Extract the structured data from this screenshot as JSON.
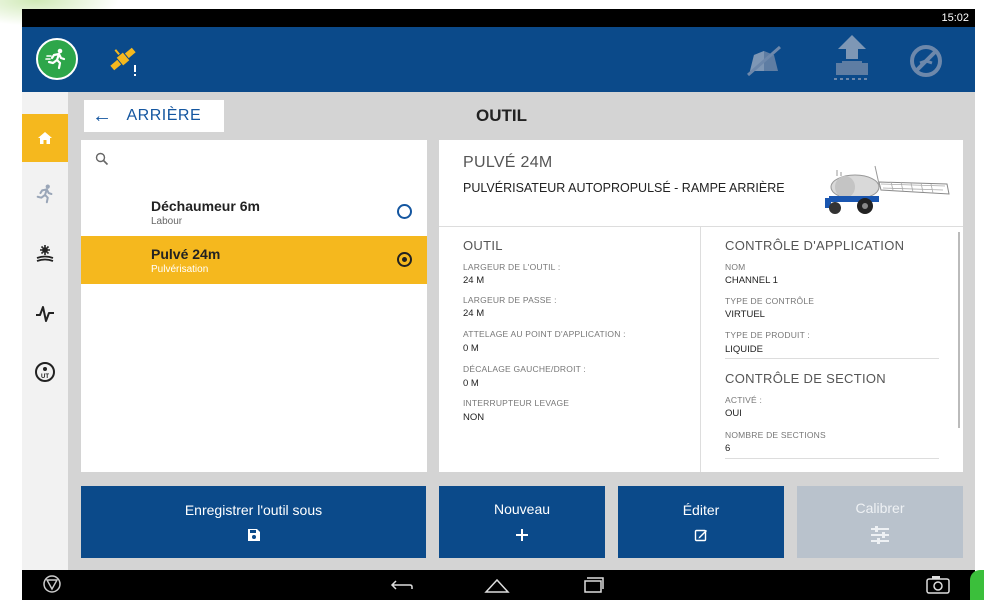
{
  "status_bar": {
    "time": "15:02"
  },
  "top_bar": {
    "run_icon": "run-icon",
    "gps_icon": "gps-warning-icon",
    "right_icons": [
      "boundary-icon",
      "guidance-icon",
      "steering-off-icon"
    ]
  },
  "sidebar": {
    "items": [
      {
        "icon": "home-icon",
        "active": true
      },
      {
        "icon": "run-icon",
        "active": false
      },
      {
        "icon": "field-icon",
        "active": false
      },
      {
        "icon": "activity-icon",
        "active": false
      },
      {
        "icon": "ut-icon",
        "active": false
      }
    ]
  },
  "header": {
    "back_label": "ARRIÈRE",
    "title": "OUTIL"
  },
  "tool_list": {
    "items": [
      {
        "name": "Déchaumeur 6m",
        "category": "Labour",
        "selected": false
      },
      {
        "name": "Pulvé 24m",
        "category": "Pulvérisation",
        "selected": true
      }
    ]
  },
  "detail": {
    "name": "PULVÉ 24M",
    "type": "PULVÉRISATEUR AUTOPROPULSÉ - RAMPE ARRIÈRE",
    "left": {
      "heading": "OUTIL",
      "fields": [
        {
          "label": "LARGEUR DE L'OUTIL :",
          "value": "24 M"
        },
        {
          "label": "LARGEUR DE PASSE :",
          "value": "24 M"
        },
        {
          "label": "ATTELAGE AU POINT D'APPLICATION :",
          "value": "0 M"
        },
        {
          "label": "DÉCALAGE GAUCHE/DROIT :",
          "value": "0 M"
        },
        {
          "label": "INTERRUPTEUR LEVAGE",
          "value": "NON"
        }
      ]
    },
    "right": {
      "heading1": "CONTRÔLE D'APPLICATION",
      "fields1": [
        {
          "label": "NOM",
          "value": "CHANNEL 1"
        },
        {
          "label": "TYPE DE CONTRÔLE",
          "value": "VIRTUEL"
        },
        {
          "label": "TYPE DE PRODUIT :",
          "value": "LIQUIDE"
        }
      ],
      "heading2": "CONTRÔLE DE SECTION",
      "fields2": [
        {
          "label": "ACTIVÉ :",
          "value": "OUI"
        },
        {
          "label": "NOMBRE DE SECTIONS",
          "value": "6"
        }
      ]
    }
  },
  "buttons": {
    "save_as": "Enregistrer l'outil sous",
    "new": "Nouveau",
    "edit": "Éditer",
    "calibrate": "Calibrer"
  },
  "colors": {
    "primary": "#0b4a8a",
    "accent": "#f5b81e",
    "green": "#2da64a",
    "disabled": "#b9c2cc"
  }
}
